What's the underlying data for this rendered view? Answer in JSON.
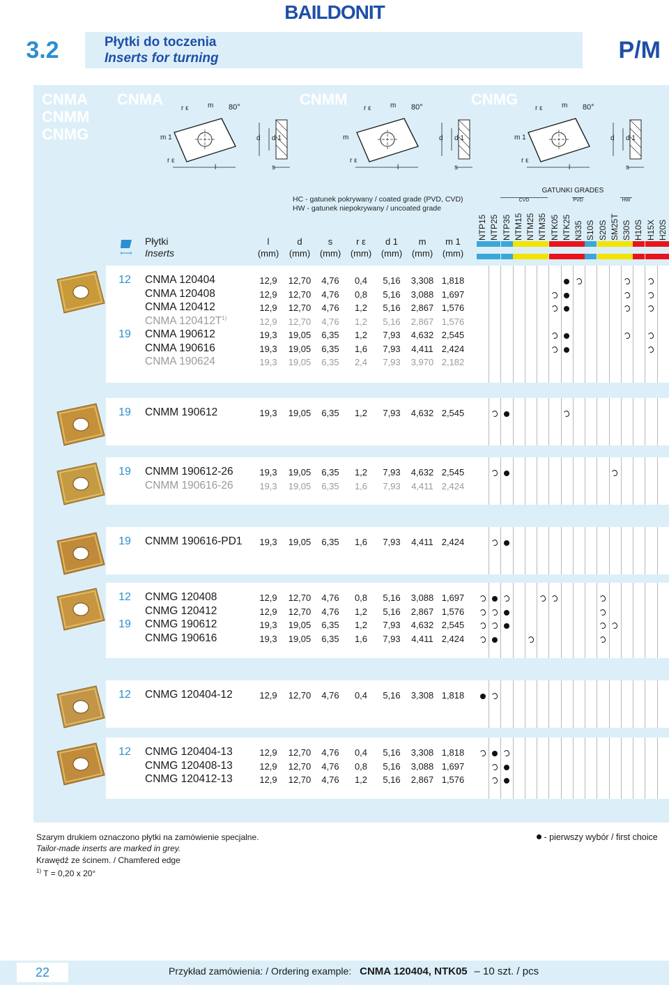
{
  "brand": "BAILDONIT",
  "section": "3.2",
  "title_pl": "Płytki do toczenia",
  "title_en": "Inserts for turning",
  "category": "P/M",
  "types_left": [
    "CNMA",
    "CNMM",
    "CNMG"
  ],
  "diagrams": [
    {
      "name": "CNMA",
      "angle": "80°",
      "labels": [
        "r ε",
        "m",
        "m 1",
        "d",
        "d 1",
        "l",
        "s",
        "r ε"
      ]
    },
    {
      "name": "CNMM",
      "angle": "80°",
      "labels": [
        "r ε",
        "m",
        "m",
        "d",
        "d 1",
        "l",
        "s",
        "r ε"
      ]
    },
    {
      "name": "CNMG",
      "angle": "80°",
      "labels": [
        "r ε",
        "m",
        "m 1",
        "d",
        "d 1",
        "l",
        "s",
        "r ε"
      ]
    }
  ],
  "notes": {
    "hc": "HC - gatunek pokrywany / coated grade (PVD, CVD)",
    "hw": "HW - gatunek niepokrywany / uncoated grade"
  },
  "header": {
    "inserts_pl": "Płytki",
    "inserts_en": "Inserts",
    "cols": [
      {
        "sym": "l",
        "unit": "(mm)"
      },
      {
        "sym": "d",
        "unit": "(mm)"
      },
      {
        "sym": "s",
        "unit": "(mm)"
      },
      {
        "sym": "r ε",
        "unit": "(mm)"
      },
      {
        "sym": "d 1",
        "unit": "(mm)"
      },
      {
        "sym": "m",
        "unit": "(mm)"
      },
      {
        "sym": "m 1",
        "unit": "(mm)"
      }
    ],
    "grades_title": "GATUNKI GRADES",
    "groups": [
      "CVD",
      "PVD",
      "HW"
    ],
    "grades": [
      "NTP15",
      "NTP25",
      "NTP35",
      "NTM15",
      "NTM25",
      "NTM35",
      "NTK05",
      "NTK25",
      "N335",
      "S10S",
      "S20S",
      "SM25T",
      "S30S",
      "H10S",
      "H15X",
      "H20S"
    ],
    "grade_colors": [
      "#3aa7d8",
      "#3aa7d8",
      "#3aa7d8",
      "#f2e400",
      "#f2e400",
      "#f2e400",
      "#e8141c",
      "#e8141c",
      "#e8141c",
      "#3aa7d8",
      "#f2e400",
      "#f2e400",
      "#f2e400",
      "#e8141c",
      "#e8141c",
      "#e8141c"
    ]
  },
  "groups": [
    {
      "rows": [
        {
          "size": "12",
          "code": "CNMA 120404",
          "sup": "",
          "grey": false,
          "v": [
            "12,9",
            "12,70",
            "4,76",
            "0,4",
            "5,16",
            "3,308",
            "1,818"
          ],
          "m": {
            "7": "dot",
            "8": "ring",
            "12": "ring",
            "14": "ring"
          }
        },
        {
          "size": "",
          "code": "CNMA 120408",
          "sup": "",
          "grey": false,
          "v": [
            "12,9",
            "12,70",
            "4,76",
            "0,8",
            "5,16",
            "3,088",
            "1,697"
          ],
          "m": {
            "6": "ring",
            "7": "dot",
            "12": "ring",
            "14": "ring"
          }
        },
        {
          "size": "",
          "code": "CNMA 120412",
          "sup": "",
          "grey": false,
          "v": [
            "12,9",
            "12,70",
            "4,76",
            "1,2",
            "5,16",
            "2,867",
            "1,576"
          ],
          "m": {
            "6": "ring",
            "7": "dot",
            "12": "ring",
            "14": "ring"
          }
        },
        {
          "size": "",
          "code": "CNMA 120412T",
          "sup": "1)",
          "grey": true,
          "v": [
            "12,9",
            "12,70",
            "4,76",
            "1,2",
            "5,16",
            "2,867",
            "1,576"
          ],
          "m": {}
        },
        {
          "size": "19",
          "code": "CNMA 190612",
          "sup": "",
          "grey": false,
          "v": [
            "19,3",
            "19,05",
            "6,35",
            "1,2",
            "7,93",
            "4,632",
            "2,545"
          ],
          "m": {
            "6": "ring",
            "7": "dot",
            "12": "ring",
            "14": "ring"
          }
        },
        {
          "size": "",
          "code": "CNMA 190616",
          "sup": "",
          "grey": false,
          "v": [
            "19,3",
            "19,05",
            "6,35",
            "1,6",
            "7,93",
            "4,411",
            "2,424"
          ],
          "m": {
            "6": "ring",
            "7": "dot",
            "14": "ring"
          }
        },
        {
          "size": "",
          "code": "CNMA 190624",
          "sup": "",
          "grey": true,
          "v": [
            "19,3",
            "19,05",
            "6,35",
            "2,4",
            "7,93",
            "3,970",
            "2,182"
          ],
          "m": {}
        }
      ]
    },
    {
      "rows": [
        {
          "size": "19",
          "code": "CNMM 190612",
          "sup": "",
          "grey": false,
          "v": [
            "19,3",
            "19,05",
            "6,35",
            "1,2",
            "7,93",
            "4,632",
            "2,545"
          ],
          "m": {
            "1": "ring",
            "2": "dot",
            "7": "ring"
          }
        }
      ]
    },
    {
      "rows": [
        {
          "size": "19",
          "code": "CNMM 190612-26",
          "sup": "",
          "grey": false,
          "v": [
            "19,3",
            "19,05",
            "6,35",
            "1,2",
            "7,93",
            "4,632",
            "2,545"
          ],
          "m": {
            "1": "ring",
            "2": "dot",
            "11": "ring"
          }
        },
        {
          "size": "",
          "code": "CNMM 190616-26",
          "sup": "",
          "grey": true,
          "v": [
            "19,3",
            "19,05",
            "6,35",
            "1,6",
            "7,93",
            "4,411",
            "2,424"
          ],
          "m": {}
        }
      ]
    },
    {
      "rows": [
        {
          "size": "19",
          "code": "CNMM 190616-PD1",
          "sup": "",
          "grey": false,
          "v": [
            "19,3",
            "19,05",
            "6,35",
            "1,6",
            "7,93",
            "4,411",
            "2,424"
          ],
          "m": {
            "1": "ring",
            "2": "dot"
          }
        }
      ]
    },
    {
      "rows": [
        {
          "size": "12",
          "code": "CNMG 120408",
          "sup": "",
          "grey": false,
          "v": [
            "12,9",
            "12,70",
            "4,76",
            "0,8",
            "5,16",
            "3,088",
            "1,697"
          ],
          "m": {
            "0": "ring",
            "1": "dot",
            "2": "ring",
            "5": "ring",
            "6": "ring",
            "10": "ring"
          }
        },
        {
          "size": "",
          "code": "CNMG 120412",
          "sup": "",
          "grey": false,
          "v": [
            "12,9",
            "12,70",
            "4,76",
            "1,2",
            "5,16",
            "2,867",
            "1,576"
          ],
          "m": {
            "0": "ring",
            "1": "ring",
            "2": "dot",
            "10": "ring"
          }
        },
        {
          "size": "19",
          "code": "CNMG 190612",
          "sup": "",
          "grey": false,
          "v": [
            "19,3",
            "19,05",
            "6,35",
            "1,2",
            "7,93",
            "4,632",
            "2,545"
          ],
          "m": {
            "0": "ring",
            "1": "ring",
            "2": "dot",
            "10": "ring",
            "11": "ring"
          }
        },
        {
          "size": "",
          "code": "CNMG 190616",
          "sup": "",
          "grey": false,
          "v": [
            "19,3",
            "19,05",
            "6,35",
            "1,6",
            "7,93",
            "4,411",
            "2,424"
          ],
          "m": {
            "0": "ring",
            "1": "dot",
            "4": "ring",
            "10": "ring"
          }
        }
      ]
    },
    {
      "rows": [
        {
          "size": "12",
          "code": "CNMG 120404-12",
          "sup": "",
          "grey": false,
          "v": [
            "12,9",
            "12,70",
            "4,76",
            "0,4",
            "5,16",
            "3,308",
            "1,818"
          ],
          "m": {
            "0": "dot",
            "1": "ring"
          }
        }
      ]
    },
    {
      "rows": [
        {
          "size": "12",
          "code": "CNMG 120404-13",
          "sup": "",
          "grey": false,
          "v": [
            "12,9",
            "12,70",
            "4,76",
            "0,4",
            "5,16",
            "3,308",
            "1,818"
          ],
          "m": {
            "0": "ring",
            "1": "dot",
            "2": "ring"
          }
        },
        {
          "size": "",
          "code": "CNMG 120408-13",
          "sup": "",
          "grey": false,
          "v": [
            "12,9",
            "12,70",
            "4,76",
            "0,8",
            "5,16",
            "3,088",
            "1,697"
          ],
          "m": {
            "1": "ring",
            "2": "dot"
          }
        },
        {
          "size": "",
          "code": "CNMG 120412-13",
          "sup": "",
          "grey": false,
          "v": [
            "12,9",
            "12,70",
            "4,76",
            "1,2",
            "5,16",
            "2,867",
            "1,576"
          ],
          "m": {
            "1": "ring",
            "2": "dot"
          }
        }
      ]
    }
  ],
  "footer": {
    "special_pl": "Szarym drukiem oznaczono płytki na zamówienie specjalne.",
    "special_en": "Tailor-made inserts are marked in grey.",
    "chamfer": "Krawędź ze ścinem. / Chamfered edge",
    "note_sup": "1)",
    "note": "T = 0,20 x 20°",
    "first_choice": "- pierwszy wybór / first choice"
  },
  "page": "22",
  "order_label": "Przykład zamówienia: / Ordering example:",
  "order_code": "CNMA 120404, NTK05",
  "order_qty": "– 10 szt. / pcs"
}
